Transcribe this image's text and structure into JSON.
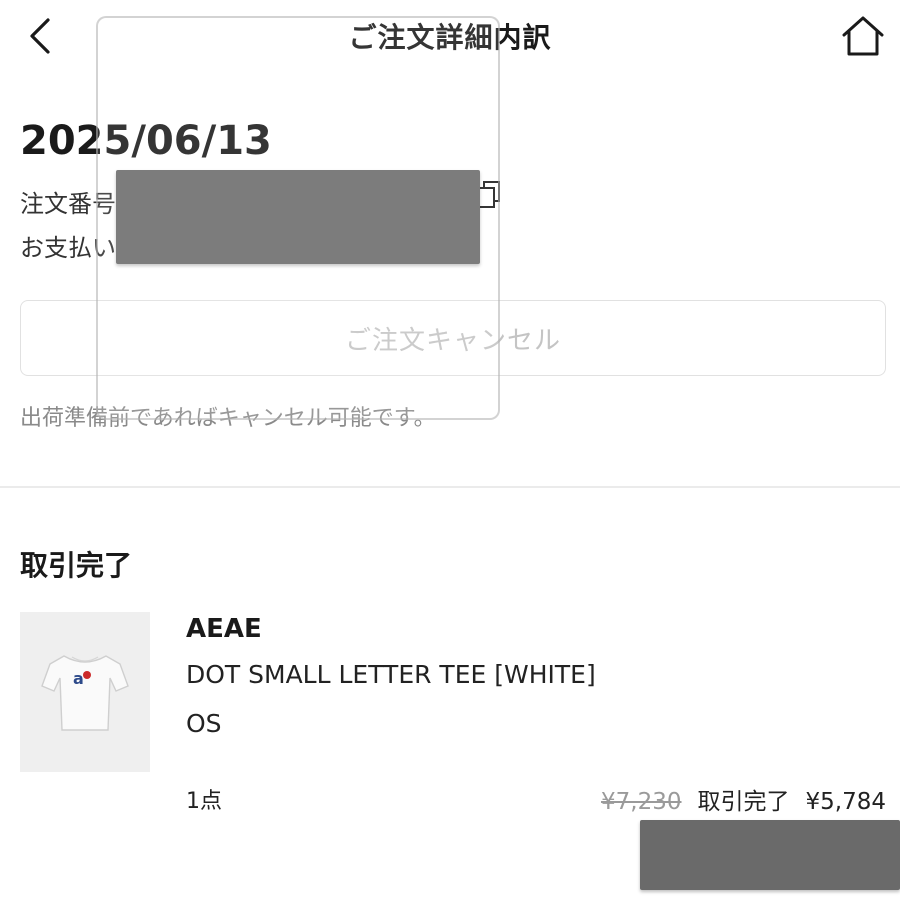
{
  "header": {
    "title": "ご注文詳細内訳",
    "back_icon": "chevron-left-icon",
    "home_icon": "home-icon"
  },
  "order": {
    "date": "2025/06/13",
    "order_number_label": "注文番号",
    "payment_label": "お支払い",
    "copy_icon": "copy-icon"
  },
  "cancel": {
    "button_label": "ご注文キャンセル",
    "note": "出荷準備前であればキャンセル可能です。"
  },
  "transaction": {
    "status_title": "取引完了",
    "item": {
      "brand": "AEAE",
      "name": "DOT SMALL LETTER TEE [WHITE]",
      "size": "OS",
      "quantity": "1点",
      "original_price": "¥7,230",
      "status": "取引完了",
      "price": "¥5,784"
    }
  },
  "colors": {
    "text": "#1a1a1a",
    "muted": "#8a8a8a",
    "disabled": "#c4c4c4",
    "redaction": "#6a6a6a",
    "divider": "#ebebeb"
  }
}
